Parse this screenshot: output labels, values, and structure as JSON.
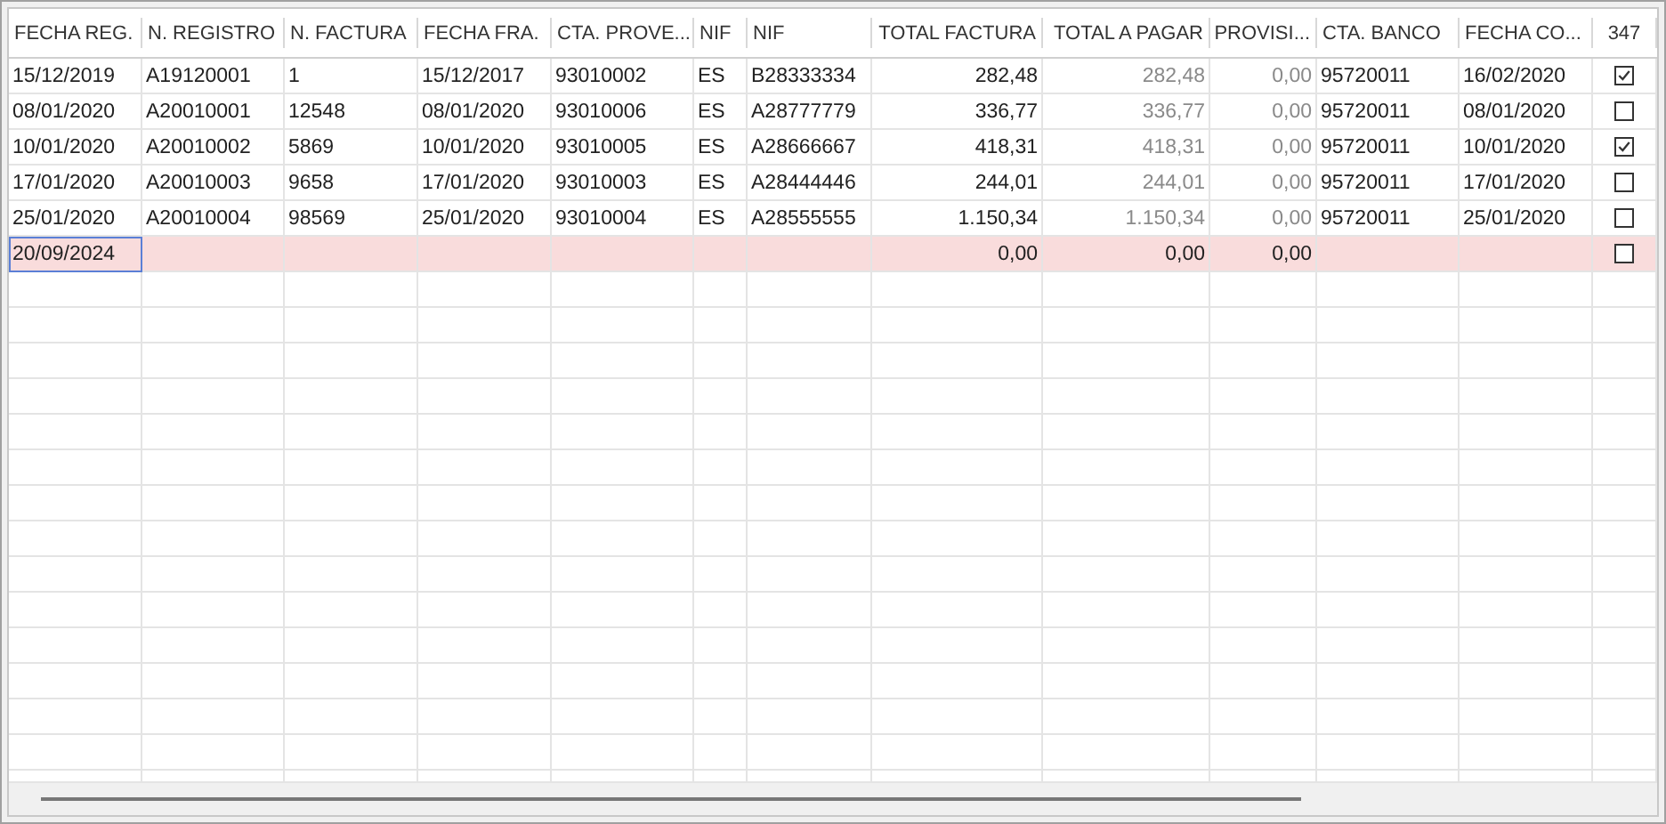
{
  "table": {
    "columns": [
      {
        "label": "FECHA REG.",
        "kind": "text"
      },
      {
        "label": "N. REGISTRO",
        "kind": "text"
      },
      {
        "label": "N. FACTURA",
        "kind": "text"
      },
      {
        "label": "FECHA FRA.",
        "kind": "text"
      },
      {
        "label": "CTA. PROVE...",
        "kind": "text"
      },
      {
        "label": "NIF",
        "kind": "text"
      },
      {
        "label": "NIF",
        "kind": "text"
      },
      {
        "label": "TOTAL FACTURA",
        "kind": "amount"
      },
      {
        "label": "TOTAL A PAGAR",
        "kind": "computed"
      },
      {
        "label": "PROVISI...",
        "kind": "computed"
      },
      {
        "label": "CTA. BANCO",
        "kind": "text"
      },
      {
        "label": "FECHA CO...",
        "kind": "text"
      },
      {
        "label": "347",
        "kind": "check"
      }
    ],
    "rows": [
      {
        "kind": "record",
        "editing": false,
        "cells": [
          "15/12/2019",
          "A19120001",
          "1",
          "15/12/2017",
          "93010002",
          "ES",
          "B28333334",
          "282,48",
          "282,48",
          "0,00",
          "95720011",
          "16/02/2020"
        ],
        "checked": true
      },
      {
        "kind": "record",
        "editing": false,
        "cells": [
          "08/01/2020",
          "A20010001",
          "12548",
          "08/01/2020",
          "93010006",
          "ES",
          "A28777779",
          "336,77",
          "336,77",
          "0,00",
          "95720011",
          "08/01/2020"
        ],
        "checked": false
      },
      {
        "kind": "record",
        "editing": false,
        "cells": [
          "10/01/2020",
          "A20010002",
          "5869",
          "10/01/2020",
          "93010005",
          "ES",
          "A28666667",
          "418,31",
          "418,31",
          "0,00",
          "95720011",
          "10/01/2020"
        ],
        "checked": true
      },
      {
        "kind": "record",
        "editing": false,
        "cells": [
          "17/01/2020",
          "A20010003",
          "9658",
          "17/01/2020",
          "93010003",
          "ES",
          "A28444446",
          "244,01",
          "244,01",
          "0,00",
          "95720011",
          "17/01/2020"
        ],
        "checked": false
      },
      {
        "kind": "record",
        "editing": false,
        "cells": [
          "25/01/2020",
          "A20010004",
          "98569",
          "25/01/2020",
          "93010004",
          "ES",
          "A28555555",
          "1.150,34",
          "1.150,34",
          "0,00",
          "95720011",
          "25/01/2020"
        ],
        "checked": false
      },
      {
        "kind": "new",
        "editing": true,
        "cells": [
          "20/09/2024",
          "",
          "",
          "",
          "",
          "",
          "",
          "0,00",
          "0,00",
          "0,00",
          "",
          ""
        ],
        "checked": false
      }
    ]
  }
}
